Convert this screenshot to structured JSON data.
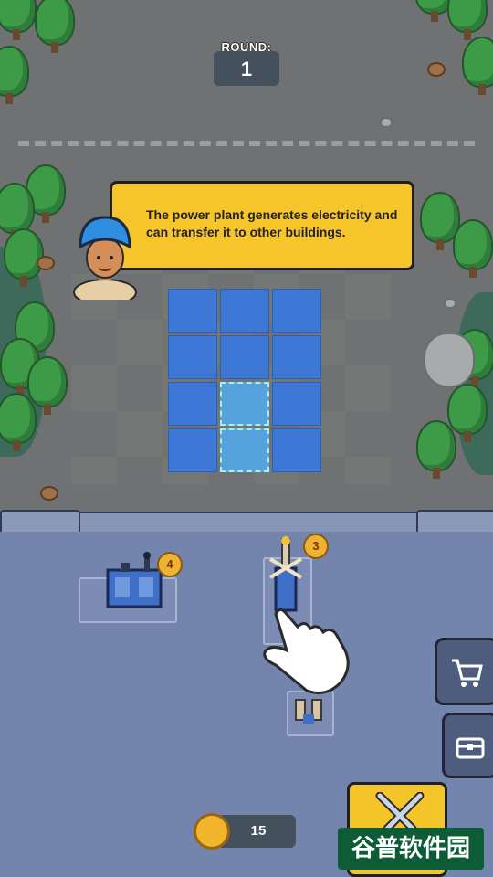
{
  "round": {
    "label": "ROUND:",
    "value": "1"
  },
  "tutorial": {
    "text": "The power plant generates electricity and can transfer it to other buildings."
  },
  "grid": {
    "rows": 4,
    "cols": 3,
    "highlighted": [
      [
        2,
        1
      ],
      [
        3,
        1
      ]
    ]
  },
  "units": [
    {
      "name": "power-plant",
      "level": "4"
    },
    {
      "name": "tower",
      "level": "3"
    }
  ],
  "coins": {
    "value": "15"
  },
  "buttons": {
    "shop": "cart-icon",
    "chest": "chest-icon",
    "battle": "crossed-swords-icon"
  },
  "watermark": {
    "text": "谷普软件园"
  },
  "colors": {
    "dialog": "#f6c52b",
    "grid": "#3e78d6",
    "base": "#7485ad",
    "battle": "#f4c52a"
  }
}
